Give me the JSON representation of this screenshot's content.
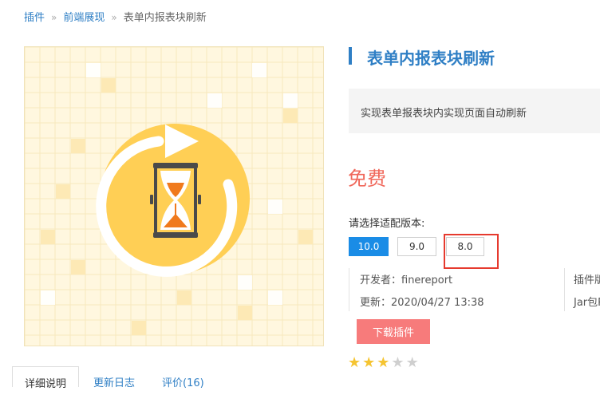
{
  "breadcrumb": {
    "root": "插件",
    "category": "前端展现",
    "current": "表单内报表块刷新",
    "separator": "»"
  },
  "plugin": {
    "title": "表单内报表块刷新",
    "description": "实现表单报表块内实现页面自动刷新",
    "price": "免费",
    "version_label": "请选择适配版本:",
    "versions": [
      "10.0",
      "9.0",
      "8.0"
    ],
    "selected_version": "10.0",
    "developer": "开发者：finereport",
    "updated": "更新：2020/04/27 13:38",
    "plugin_info_partial": "插件版",
    "jar_info_partial": "Jar包R",
    "download_label": "下载插件",
    "rating": 3,
    "rating_max": 5,
    "icon": "hourglass-refresh-icon"
  },
  "tabs": {
    "details": "详细说明",
    "changelog": "更新日志",
    "reviews": "评价(16)"
  },
  "colors": {
    "accent": "#2f7fc5",
    "price": "#f0675a",
    "download": "#f77b7b",
    "version_active": "#1a8ce6",
    "highlight": "#e63a2e",
    "star": "#f5c431"
  }
}
